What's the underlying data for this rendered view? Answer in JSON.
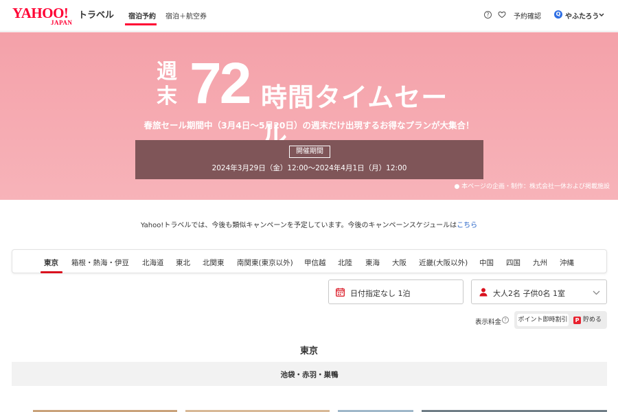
{
  "header": {
    "logo_main": "YAHOO!",
    "logo_sub": "JAPAN",
    "logo_service": "トラベル",
    "tabs": [
      {
        "label": "宿泊予約",
        "active": true
      },
      {
        "label": "宿泊＋航空券",
        "active": false
      }
    ],
    "help_icon": "question-circle-icon",
    "favorite_icon": "heart-icon",
    "reservation_label": "予約確認",
    "user_badge_icon": "Q",
    "user_name": "やふたろう",
    "accent_color": "#ff0033"
  },
  "hero": {
    "title_prefix": "週末",
    "title_number": "72",
    "title_rest": "時間タイムセール",
    "subtitle": "春旅セール期間中（3月4日〜5月20日）の週末だけ出現するお得なプランが大集合！",
    "period_tag": "開催期間",
    "period_text": "2024年3月29日（金）12:00〜2024年4月1日（月）12:00",
    "credit": "● 本ページの企画・制作：株式会社一休および掲載施設",
    "background_color": "#f6abb2"
  },
  "notice": {
    "text": "Yahoo!トラベルでは、今後も類似キャンペーンを予定しています。今後のキャンペーンスケジュールは",
    "link": "こちら"
  },
  "regions": [
    {
      "label": "東京",
      "active": true
    },
    {
      "label": "箱根・熱海・伊豆"
    },
    {
      "label": "北海道"
    },
    {
      "label": "東北"
    },
    {
      "label": "北関東"
    },
    {
      "label": "南関東(東京以外)"
    },
    {
      "label": "甲信越"
    },
    {
      "label": "北陸"
    },
    {
      "label": "東海"
    },
    {
      "label": "大阪"
    },
    {
      "label": "近畿(大阪以外)"
    },
    {
      "label": "中国"
    },
    {
      "label": "四国"
    },
    {
      "label": "九州"
    },
    {
      "label": "沖縄"
    }
  ],
  "search": {
    "date_label": "日付指定なし 1泊",
    "date_icon": "calendar-icon",
    "people_label": "大人2名  子供0名  1室",
    "people_icon": "person-icon",
    "people_chevron": "chevron-down-icon",
    "price_display_label": "表示料金",
    "price_help_icon": "?",
    "toggle_option_a": "ポイント即時割引",
    "toggle_option_b": "貯める",
    "toggle_option_b_icon": "P"
  },
  "section": {
    "title": "東京",
    "area": "池袋・赤羽・巣鴨"
  }
}
